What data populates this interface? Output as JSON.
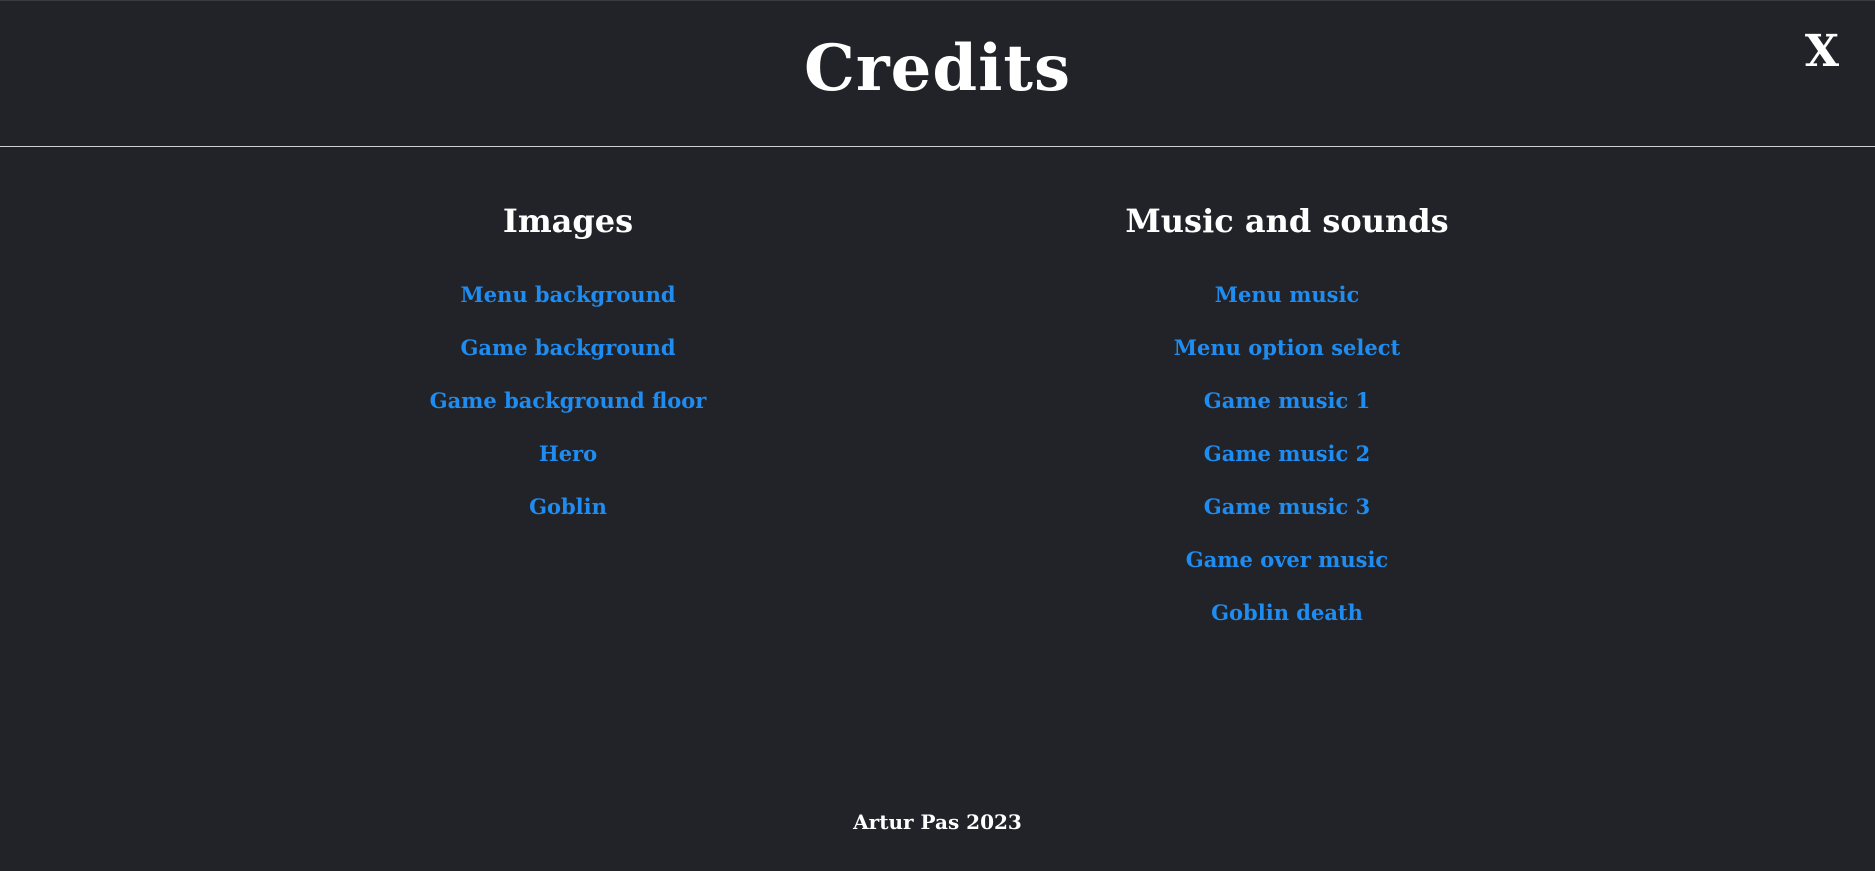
{
  "header": {
    "title": "Credits",
    "close_label": "X"
  },
  "columns": [
    {
      "heading": "Images",
      "links": [
        "Menu background",
        "Game background",
        "Game background floor",
        "Hero",
        "Goblin"
      ]
    },
    {
      "heading": "Music and sounds",
      "links": [
        "Menu music",
        "Menu option select",
        "Game music 1",
        "Game music 2",
        "Game music 3",
        "Game over music",
        "Goblin death"
      ]
    }
  ],
  "footer": {
    "text": "Artur Pas 2023"
  },
  "colors": {
    "background": "#222328",
    "link": "#1e8cf0",
    "text": "#ffffff",
    "divider": "#cfd0d4"
  }
}
